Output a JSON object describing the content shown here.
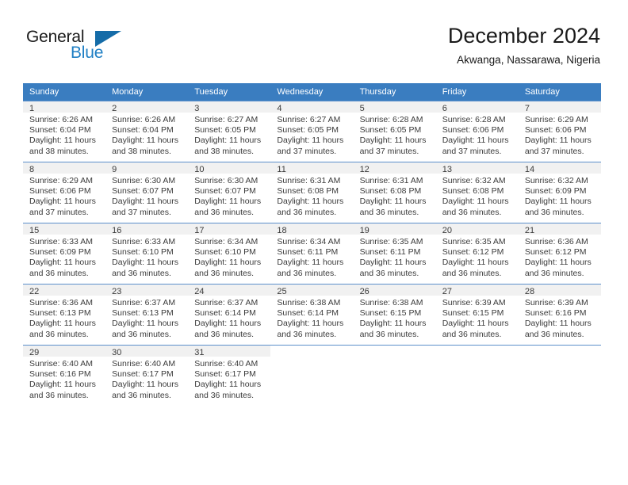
{
  "brand": {
    "name_part1": "General",
    "name_part2": "Blue",
    "triangle_color": "#156ca8",
    "blue_color": "#1f7fc4"
  },
  "header": {
    "title": "December 2024",
    "subtitle": "Akwanga, Nassarawa, Nigeria"
  },
  "theme": {
    "header_row_bg": "#3a7dc0",
    "header_row_text": "#ffffff",
    "daynum_band_bg": "#f1f1f1",
    "row_divider": "#5c8fcb",
    "body_text": "#3b3b3b"
  },
  "weekday_headers": [
    "Sunday",
    "Monday",
    "Tuesday",
    "Wednesday",
    "Thursday",
    "Friday",
    "Saturday"
  ],
  "weeks": [
    [
      {
        "day": "1",
        "sunrise": "Sunrise: 6:26 AM",
        "sunset": "Sunset: 6:04 PM",
        "daylight1": "Daylight: 11 hours",
        "daylight2": "and 38 minutes."
      },
      {
        "day": "2",
        "sunrise": "Sunrise: 6:26 AM",
        "sunset": "Sunset: 6:04 PM",
        "daylight1": "Daylight: 11 hours",
        "daylight2": "and 38 minutes."
      },
      {
        "day": "3",
        "sunrise": "Sunrise: 6:27 AM",
        "sunset": "Sunset: 6:05 PM",
        "daylight1": "Daylight: 11 hours",
        "daylight2": "and 38 minutes."
      },
      {
        "day": "4",
        "sunrise": "Sunrise: 6:27 AM",
        "sunset": "Sunset: 6:05 PM",
        "daylight1": "Daylight: 11 hours",
        "daylight2": "and 37 minutes."
      },
      {
        "day": "5",
        "sunrise": "Sunrise: 6:28 AM",
        "sunset": "Sunset: 6:05 PM",
        "daylight1": "Daylight: 11 hours",
        "daylight2": "and 37 minutes."
      },
      {
        "day": "6",
        "sunrise": "Sunrise: 6:28 AM",
        "sunset": "Sunset: 6:06 PM",
        "daylight1": "Daylight: 11 hours",
        "daylight2": "and 37 minutes."
      },
      {
        "day": "7",
        "sunrise": "Sunrise: 6:29 AM",
        "sunset": "Sunset: 6:06 PM",
        "daylight1": "Daylight: 11 hours",
        "daylight2": "and 37 minutes."
      }
    ],
    [
      {
        "day": "8",
        "sunrise": "Sunrise: 6:29 AM",
        "sunset": "Sunset: 6:06 PM",
        "daylight1": "Daylight: 11 hours",
        "daylight2": "and 37 minutes."
      },
      {
        "day": "9",
        "sunrise": "Sunrise: 6:30 AM",
        "sunset": "Sunset: 6:07 PM",
        "daylight1": "Daylight: 11 hours",
        "daylight2": "and 37 minutes."
      },
      {
        "day": "10",
        "sunrise": "Sunrise: 6:30 AM",
        "sunset": "Sunset: 6:07 PM",
        "daylight1": "Daylight: 11 hours",
        "daylight2": "and 36 minutes."
      },
      {
        "day": "11",
        "sunrise": "Sunrise: 6:31 AM",
        "sunset": "Sunset: 6:08 PM",
        "daylight1": "Daylight: 11 hours",
        "daylight2": "and 36 minutes."
      },
      {
        "day": "12",
        "sunrise": "Sunrise: 6:31 AM",
        "sunset": "Sunset: 6:08 PM",
        "daylight1": "Daylight: 11 hours",
        "daylight2": "and 36 minutes."
      },
      {
        "day": "13",
        "sunrise": "Sunrise: 6:32 AM",
        "sunset": "Sunset: 6:08 PM",
        "daylight1": "Daylight: 11 hours",
        "daylight2": "and 36 minutes."
      },
      {
        "day": "14",
        "sunrise": "Sunrise: 6:32 AM",
        "sunset": "Sunset: 6:09 PM",
        "daylight1": "Daylight: 11 hours",
        "daylight2": "and 36 minutes."
      }
    ],
    [
      {
        "day": "15",
        "sunrise": "Sunrise: 6:33 AM",
        "sunset": "Sunset: 6:09 PM",
        "daylight1": "Daylight: 11 hours",
        "daylight2": "and 36 minutes."
      },
      {
        "day": "16",
        "sunrise": "Sunrise: 6:33 AM",
        "sunset": "Sunset: 6:10 PM",
        "daylight1": "Daylight: 11 hours",
        "daylight2": "and 36 minutes."
      },
      {
        "day": "17",
        "sunrise": "Sunrise: 6:34 AM",
        "sunset": "Sunset: 6:10 PM",
        "daylight1": "Daylight: 11 hours",
        "daylight2": "and 36 minutes."
      },
      {
        "day": "18",
        "sunrise": "Sunrise: 6:34 AM",
        "sunset": "Sunset: 6:11 PM",
        "daylight1": "Daylight: 11 hours",
        "daylight2": "and 36 minutes."
      },
      {
        "day": "19",
        "sunrise": "Sunrise: 6:35 AM",
        "sunset": "Sunset: 6:11 PM",
        "daylight1": "Daylight: 11 hours",
        "daylight2": "and 36 minutes."
      },
      {
        "day": "20",
        "sunrise": "Sunrise: 6:35 AM",
        "sunset": "Sunset: 6:12 PM",
        "daylight1": "Daylight: 11 hours",
        "daylight2": "and 36 minutes."
      },
      {
        "day": "21",
        "sunrise": "Sunrise: 6:36 AM",
        "sunset": "Sunset: 6:12 PM",
        "daylight1": "Daylight: 11 hours",
        "daylight2": "and 36 minutes."
      }
    ],
    [
      {
        "day": "22",
        "sunrise": "Sunrise: 6:36 AM",
        "sunset": "Sunset: 6:13 PM",
        "daylight1": "Daylight: 11 hours",
        "daylight2": "and 36 minutes."
      },
      {
        "day": "23",
        "sunrise": "Sunrise: 6:37 AM",
        "sunset": "Sunset: 6:13 PM",
        "daylight1": "Daylight: 11 hours",
        "daylight2": "and 36 minutes."
      },
      {
        "day": "24",
        "sunrise": "Sunrise: 6:37 AM",
        "sunset": "Sunset: 6:14 PM",
        "daylight1": "Daylight: 11 hours",
        "daylight2": "and 36 minutes."
      },
      {
        "day": "25",
        "sunrise": "Sunrise: 6:38 AM",
        "sunset": "Sunset: 6:14 PM",
        "daylight1": "Daylight: 11 hours",
        "daylight2": "and 36 minutes."
      },
      {
        "day": "26",
        "sunrise": "Sunrise: 6:38 AM",
        "sunset": "Sunset: 6:15 PM",
        "daylight1": "Daylight: 11 hours",
        "daylight2": "and 36 minutes."
      },
      {
        "day": "27",
        "sunrise": "Sunrise: 6:39 AM",
        "sunset": "Sunset: 6:15 PM",
        "daylight1": "Daylight: 11 hours",
        "daylight2": "and 36 minutes."
      },
      {
        "day": "28",
        "sunrise": "Sunrise: 6:39 AM",
        "sunset": "Sunset: 6:16 PM",
        "daylight1": "Daylight: 11 hours",
        "daylight2": "and 36 minutes."
      }
    ],
    [
      {
        "day": "29",
        "sunrise": "Sunrise: 6:40 AM",
        "sunset": "Sunset: 6:16 PM",
        "daylight1": "Daylight: 11 hours",
        "daylight2": "and 36 minutes."
      },
      {
        "day": "30",
        "sunrise": "Sunrise: 6:40 AM",
        "sunset": "Sunset: 6:17 PM",
        "daylight1": "Daylight: 11 hours",
        "daylight2": "and 36 minutes."
      },
      {
        "day": "31",
        "sunrise": "Sunrise: 6:40 AM",
        "sunset": "Sunset: 6:17 PM",
        "daylight1": "Daylight: 11 hours",
        "daylight2": "and 36 minutes."
      },
      {
        "day": "",
        "sunrise": "",
        "sunset": "",
        "daylight1": "",
        "daylight2": ""
      },
      {
        "day": "",
        "sunrise": "",
        "sunset": "",
        "daylight1": "",
        "daylight2": ""
      },
      {
        "day": "",
        "sunrise": "",
        "sunset": "",
        "daylight1": "",
        "daylight2": ""
      },
      {
        "day": "",
        "sunrise": "",
        "sunset": "",
        "daylight1": "",
        "daylight2": ""
      }
    ]
  ]
}
